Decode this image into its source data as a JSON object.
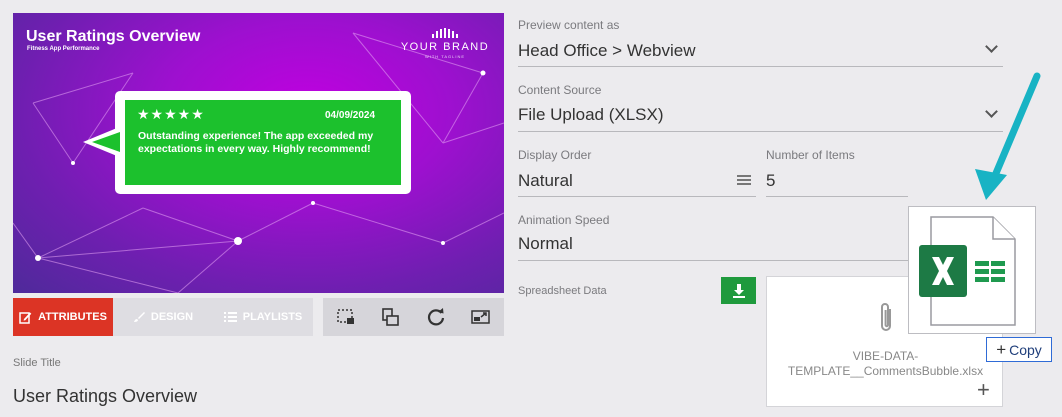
{
  "preview": {
    "title": "User Ratings Overview",
    "subtitle": "Fitness App Performance",
    "brand_name": "YOUR BRAND",
    "brand_tagline": "WITH TAGLINE",
    "review": {
      "stars": "★★★★★",
      "rating": 5,
      "date": "04/09/2024",
      "text": "Outstanding experience! The app exceeded my expectations in every way. Highly recommend!"
    }
  },
  "tabs": [
    {
      "label": "ATTRIBUTES",
      "icon": "edit-icon",
      "active": true
    },
    {
      "label": "DESIGN",
      "icon": "brush-icon",
      "active": false
    },
    {
      "label": "PLAYLISTS",
      "icon": "list-icon",
      "active": false
    }
  ],
  "tools": [
    "crop-icon",
    "layers-icon",
    "refresh-icon",
    "resize-icon"
  ],
  "slide_title": {
    "label": "Slide Title",
    "value": "User Ratings Overview"
  },
  "form": {
    "preview_as": {
      "label": "Preview content as",
      "value": "Head Office > Webview"
    },
    "content_source": {
      "label": "Content Source",
      "value": "File Upload (XLSX)"
    },
    "display_order": {
      "label": "Display Order",
      "value": "Natural"
    },
    "number_of_items": {
      "label": "Number of Items",
      "value": "5"
    },
    "animation_speed": {
      "label": "Animation Speed",
      "value": "Normal"
    },
    "spreadsheet": {
      "label": "Spreadsheet Data",
      "filename_line1": "VIBE-DATA-",
      "filename_line2": "TEMPLATE__CommentsBubble.xlsx"
    }
  },
  "drag": {
    "copy_label": "Copy"
  },
  "colors": {
    "active_tab": "#dc3425",
    "download": "#1f9a3d",
    "excel": "#1d7a45",
    "arrow": "#18b3c4",
    "bubble": "#1cc12d"
  }
}
